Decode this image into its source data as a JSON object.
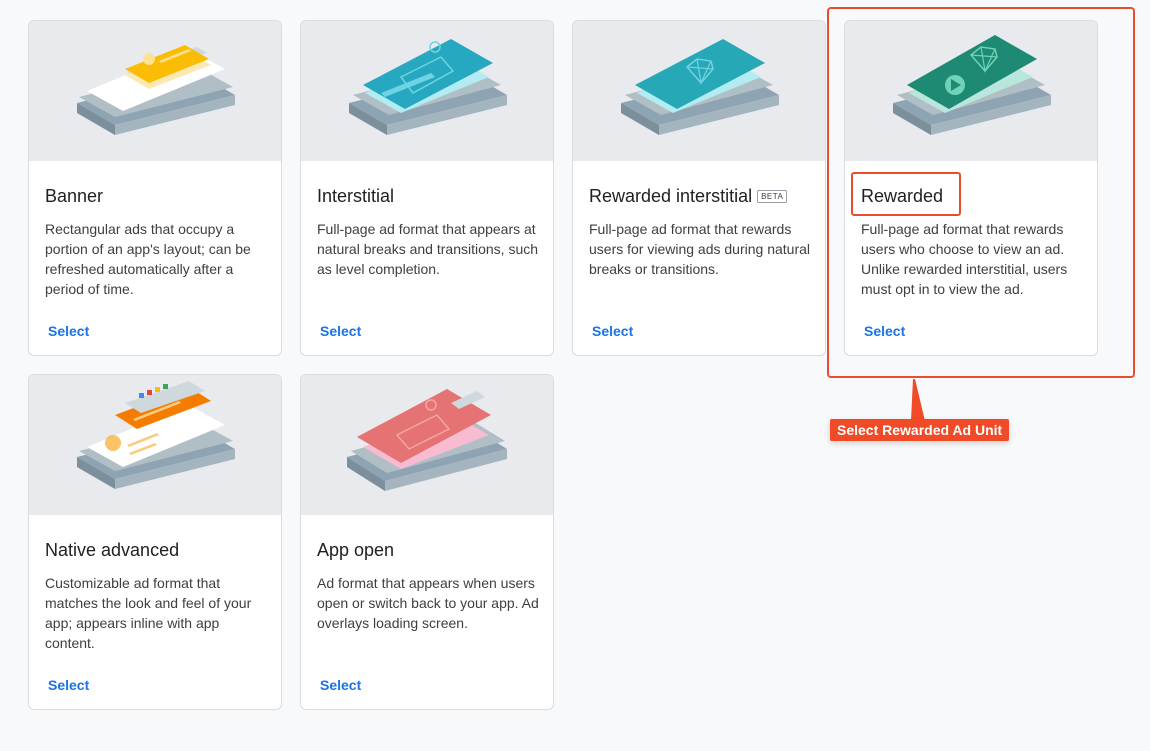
{
  "cards": [
    {
      "title": "Banner",
      "description": "Rectangular ads that occupy a portion of an app's layout; can be refreshed automatically after a period of time.",
      "select_label": "Select",
      "illustration": "banner-ad-illustration"
    },
    {
      "title": "Interstitial",
      "description": "Full-page ad format that appears at natural breaks and transitions, such as level completion.",
      "select_label": "Select",
      "illustration": "interstitial-ad-illustration"
    },
    {
      "title": "Rewarded interstitial",
      "badge": "BETA",
      "description": "Full-page ad format that rewards users for viewing ads during natural breaks or transitions.",
      "select_label": "Select",
      "illustration": "rewarded-interstitial-ad-illustration"
    },
    {
      "title": "Rewarded",
      "description": "Full-page ad format that rewards users who choose to view an ad. Unlike rewarded interstitial, users must opt in to view the ad.",
      "select_label": "Select",
      "illustration": "rewarded-ad-illustration"
    },
    {
      "title": "Native advanced",
      "description": "Customizable ad format that matches the look and feel of your app; appears inline with app content.",
      "select_label": "Select",
      "illustration": "native-advanced-ad-illustration"
    },
    {
      "title": "App open",
      "description": "Ad format that appears when users open or switch back to your app. Ad overlays loading screen.",
      "select_label": "Select",
      "illustration": "app-open-ad-illustration"
    }
  ],
  "annotation": {
    "callout_text": "Select Rewarded Ad Unit",
    "color": "#f04a26"
  },
  "colors": {
    "link": "#1a73e8",
    "card_art_bg": "#e8eaed",
    "page_bg": "#f8f9fa"
  }
}
